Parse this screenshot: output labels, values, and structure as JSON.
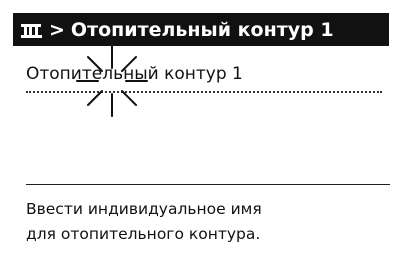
{
  "header": {
    "home_icon": "menu-root-icon",
    "separator": ">",
    "title": "Отопительный контур 1"
  },
  "field": {
    "value": "Отопительный контур 1",
    "cursor_icon": "cursor-sparkle-icon"
  },
  "help": {
    "line1": "Ввести индивидуальное имя",
    "line2": "для отопительного контура."
  }
}
